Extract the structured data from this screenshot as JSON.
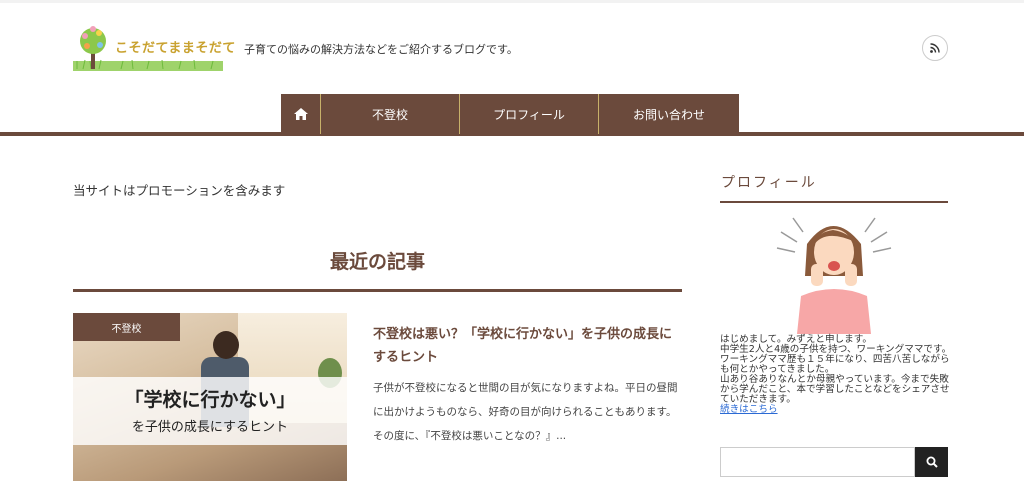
{
  "site": {
    "logo_text": "こそだてままそだて",
    "tagline": "子育ての悩みの解決方法などをご紹介するブログです。"
  },
  "nav": {
    "items": [
      {
        "label": "不登校"
      },
      {
        "label": "プロフィール"
      },
      {
        "label": "お問い合わせ"
      }
    ]
  },
  "main": {
    "promo_notice": "当サイトはプロモーションを含みます",
    "section_title": "最近の記事",
    "posts": [
      {
        "category": "不登校",
        "thumbnail_text_1": "「学校に行かない」",
        "thumbnail_text_2": "を子供の成長にするヒント",
        "title": "不登校は悪い？「学校に行かない」を子供の成長にするヒント",
        "excerpt": "子供が不登校になると世間の目が気になりますよね。平日の昼間に出かけようものなら、好奇の目が向けられることもあります。その度に、『不登校は悪いことなの？』..."
      }
    ]
  },
  "sidebar": {
    "profile_title": "プロフィール",
    "profile_lines": [
      "はじめまして。みずえと申します。",
      "中学生2人と4歳の子供を持つ、ワーキングママです。",
      "ワーキングママ歴も１５年になり、四苦八苦しながらも何とかやってきました。",
      "山あり谷ありなんとか母親やっています。今まで失敗から学んだこと、本で学習したことなどをシェアさせていただきます。"
    ],
    "profile_link": "続きはこちら",
    "search_placeholder": ""
  },
  "colors": {
    "brand": "#6b4a3c",
    "nav_divider": "#c8b16a",
    "link": "#2b6ad4"
  }
}
